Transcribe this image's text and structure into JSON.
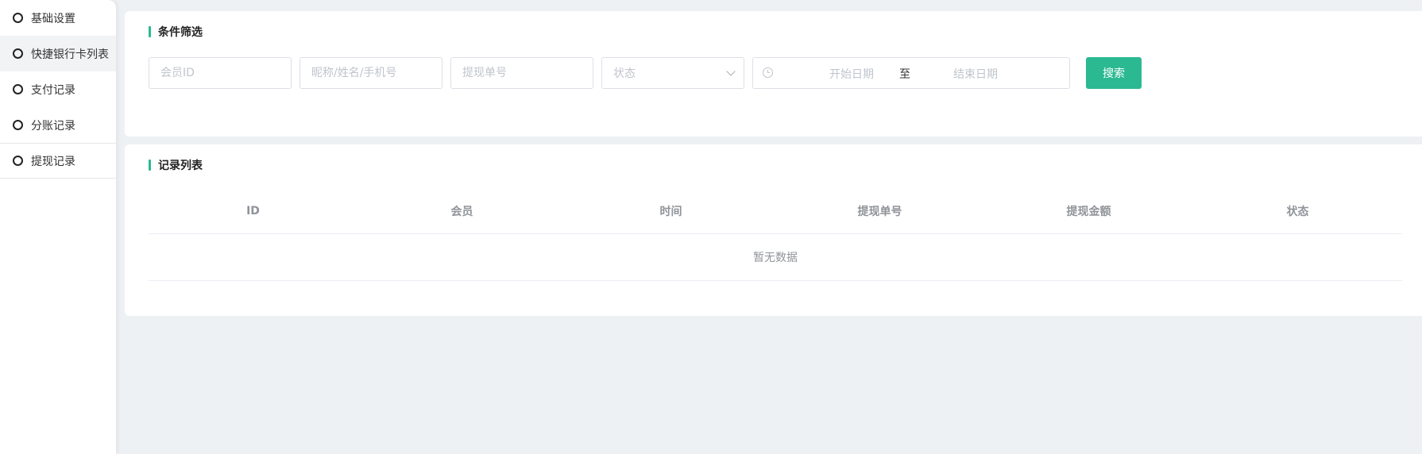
{
  "sidebar": {
    "items": [
      {
        "label": "基础设置"
      },
      {
        "label": "快捷银行卡列表"
      },
      {
        "label": "支付记录"
      },
      {
        "label": "分账记录"
      },
      {
        "label": "提现记录"
      }
    ]
  },
  "filter": {
    "title": "条件筛选",
    "member_id_placeholder": "会员ID",
    "name_placeholder": "昵称/姓名/手机号",
    "order_no_placeholder": "提现单号",
    "status_placeholder": "状态",
    "start_date_placeholder": "开始日期",
    "range_separator": "至",
    "end_date_placeholder": "结束日期",
    "search_label": "搜索"
  },
  "records": {
    "title": "记录列表",
    "columns": [
      "ID",
      "会员",
      "时间",
      "提现单号",
      "提现金额",
      "状态"
    ],
    "empty_text": "暂无数据"
  },
  "colors": {
    "accent": "#2bb992",
    "background": "#eef1f4"
  }
}
